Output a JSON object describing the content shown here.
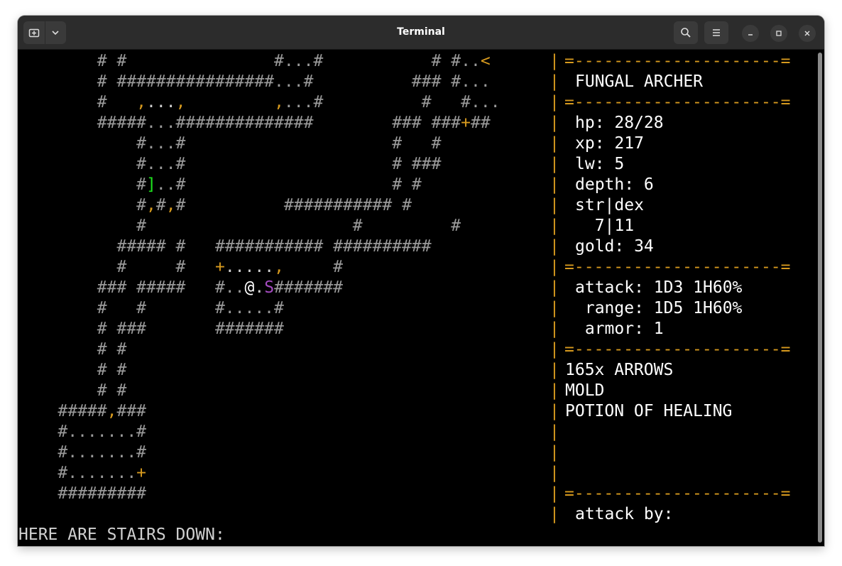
{
  "window": {
    "title": "Terminal",
    "buttons": [
      "new-tab-icon",
      "chevron-down-icon",
      "search-icon",
      "hamburger-menu-icon",
      "minimize-icon",
      "maximize-icon",
      "close-icon"
    ]
  },
  "colors": {
    "background": "#000000",
    "wall": "#9a9a9a",
    "floor": "#d0d0d0",
    "player": "#ffffff",
    "door_and_panel_border": "#d79a1e",
    "item_bracket": "#1ee21e",
    "monster_S": "#a34bbf"
  },
  "map_lines": [
    [
      {
        "t": "        # #               #...#           # #..",
        "c": "w"
      },
      {
        "t": "<",
        "c": "o"
      }
    ],
    [
      {
        "t": "        # ################...#          ### #...",
        "c": "w"
      }
    ],
    [
      {
        "t": "        #   ",
        "c": "w"
      },
      {
        "t": ",",
        "c": "o"
      },
      {
        "t": "...",
        "c": "fl"
      },
      {
        "t": ",",
        "c": "o"
      },
      {
        "t": "         ",
        "c": "w"
      },
      {
        "t": ",",
        "c": "o"
      },
      {
        "t": "...#          #   #...",
        "c": "w"
      }
    ],
    [
      {
        "t": "        #####...##############        ### ###",
        "c": "w"
      },
      {
        "t": "+",
        "c": "o"
      },
      {
        "t": "##",
        "c": "w"
      }
    ],
    [
      {
        "t": "            #...#                     #   #",
        "c": "w"
      }
    ],
    [
      {
        "t": "            #...#                     # ###",
        "c": "w"
      }
    ],
    [
      {
        "t": "            #",
        "c": "w"
      },
      {
        "t": "]",
        "c": "grn"
      },
      {
        "t": "..#                     # #",
        "c": "w"
      }
    ],
    [
      {
        "t": "            #",
        "c": "w"
      },
      {
        "t": ",",
        "c": "o"
      },
      {
        "t": "#",
        "c": "w"
      },
      {
        "t": ",",
        "c": "o"
      },
      {
        "t": "#          ########### #",
        "c": "w"
      }
    ],
    [
      {
        "t": "            #                     #         #",
        "c": "w"
      }
    ],
    [
      {
        "t": "          ##### #   ########### ##########",
        "c": "w"
      }
    ],
    [
      {
        "t": "          #     #   ",
        "c": "w"
      },
      {
        "t": "+",
        "c": "o"
      },
      {
        "t": ".....",
        "c": "fl"
      },
      {
        "t": ",",
        "c": "o"
      },
      {
        "t": "     #",
        "c": "w"
      }
    ],
    [
      {
        "t": "        ### #####   #..",
        "c": "w"
      },
      {
        "t": "@",
        "c": "g"
      },
      {
        "t": ".",
        "c": "fl"
      },
      {
        "t": "S",
        "c": "pur"
      },
      {
        "t": "#######",
        "c": "w"
      }
    ],
    [
      {
        "t": "        #   #       #.....#",
        "c": "w"
      }
    ],
    [
      {
        "t": "        # ###       #######",
        "c": "w"
      }
    ],
    [
      {
        "t": "        # #",
        "c": "w"
      }
    ],
    [
      {
        "t": "        # #",
        "c": "w"
      }
    ],
    [
      {
        "t": "        # #",
        "c": "w"
      }
    ],
    [
      {
        "t": "    #####",
        "c": "w"
      },
      {
        "t": ",",
        "c": "o"
      },
      {
        "t": "###",
        "c": "w"
      }
    ],
    [
      {
        "t": "    #.......#",
        "c": "w"
      }
    ],
    [
      {
        "t": "    #.......#",
        "c": "w"
      }
    ],
    [
      {
        "t": "    #.......",
        "c": "w"
      },
      {
        "t": "+",
        "c": "o"
      }
    ],
    [
      {
        "t": "    #########",
        "c": "w"
      }
    ]
  ],
  "panel": {
    "separator": "=---------------------=",
    "divider_char": "|",
    "name": "FUNGAL ARCHER",
    "hp": "hp: 28/28",
    "xp": "xp: 217",
    "lw": "lw: 5",
    "depth": "depth: 6",
    "str_dex_label": "str|dex",
    "str_dex_value": "  7|11",
    "gold": "gold: 34",
    "attack": "attack: 1D3 1H60%",
    "range": " range: 1D5 1H60%",
    "armor": " armor: 1",
    "inventory": [
      "165x ARROWS",
      "MOLD",
      "POTION OF HEALING"
    ],
    "attack_by": "attack by:"
  },
  "status_line": "HERE ARE STAIRS DOWN:"
}
